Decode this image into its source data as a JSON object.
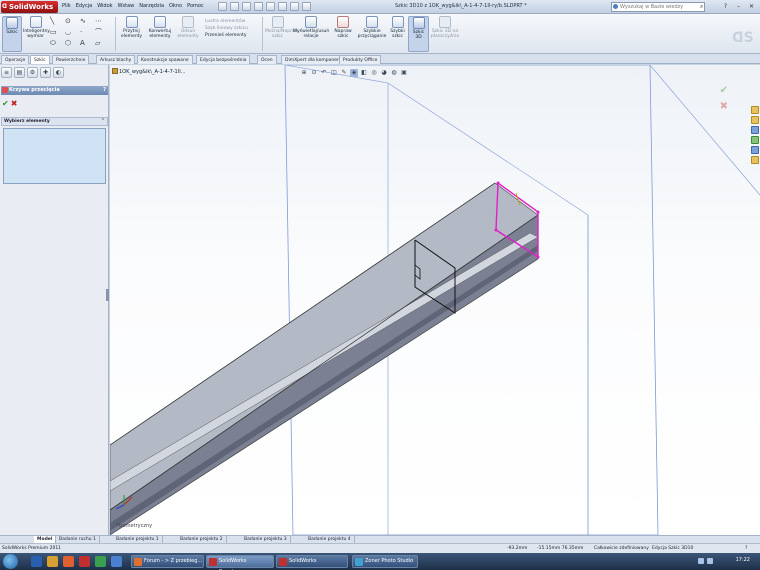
{
  "app": {
    "brand": "SolidWorks",
    "document_title": "Szkic 3D10 z 1OK_wyg&ik\\_A-1-4-7-1II-ry/b.SLDPRT *"
  },
  "menu": [
    "Plik",
    "Edycja",
    "Widok",
    "Wstaw",
    "Narzędzia",
    "Okno",
    "Pomoc"
  ],
  "search": {
    "placeholder": "Wyszukaj w Bazie wiedzy"
  },
  "ribbon": {
    "sketch": "Szkic",
    "smart_dimension": "Inteligentny wymiar",
    "trim": "Przytnij elementy",
    "convert": "Konwertuj elementy",
    "offset": "Odsuń elementy",
    "mirror": "Lustro elementów",
    "linear_pattern": "Szyk liniowy szkicu",
    "move": "Przenieś elementy",
    "repair": "Można/Napraw szkic",
    "relations": "Wyświetlaj/usuń relacje",
    "fix_sketch": "Napraw szkic",
    "quick_snaps": "Szybkie przyciąganie",
    "rapid_sketch": "Szybki szkic",
    "sketch_3d": "Szkic 3D",
    "sketch_3d_plane": "Szkic 3D na płaszczyźnie"
  },
  "tabs": [
    "Operacje",
    "Szkic",
    "Powierzchnie",
    "Arkusz blachy",
    "Konstrukcje spawane",
    "Edycja bezpośrednia",
    "Ocen",
    "DimXpert dla komponentów",
    "Produkty Office"
  ],
  "active_tab": "Szkic",
  "tree": {
    "root": "1OK_wyg&ik\\_A-1-4-7-1II..."
  },
  "property_manager": {
    "title": "Krzywa przecięcia",
    "help": "?",
    "section": "Wybierz elementy"
  },
  "viewport": {
    "view_label": "*Izometryczny"
  },
  "bottom_tabs": [
    "Model",
    "Badanie ruchu 1",
    "Badanie projektu 1",
    "Badanie projektu 2",
    "Badanie projektu 3",
    "Badanie projektu 4"
  ],
  "status": {
    "product": "SolidWorks Premium 2011",
    "x": "-93.2mm",
    "y": "-15.15mm 76.35mm",
    "state": "Całkowicie zdefiniowany",
    "mode": "Edycja Szkic 3D10"
  },
  "taskbar": {
    "items": [
      "Forum - > Z przebieg...",
      "SolidWorks Premium...",
      "SolidWorks",
      "Zoner Photo Studio ..."
    ],
    "clock": "17:22"
  },
  "colors": {
    "accent": "#c4d3ea",
    "brand": "#c02020",
    "sketch_magenta": "#e020c8"
  }
}
